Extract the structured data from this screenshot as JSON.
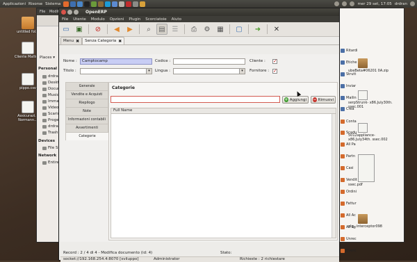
{
  "top_panel": {
    "menu": [
      "Applicazioni",
      "Risorse",
      "Sistema"
    ],
    "datetime": "mer 29 set, 17:05",
    "user": "drdran"
  },
  "desktop_icons": [
    {
      "label": "untitled fol..."
    },
    {
      "label": "Cliente Matte..."
    },
    {
      "label": "pippo.csv"
    },
    {
      "label": "Assicurazi... Normann..."
    }
  ],
  "file_manager_left": {
    "menu": [
      "File",
      "Modifi"
    ],
    "places_button": "Places ▾",
    "sections": {
      "personal": "Personal",
      "devices": "Devices",
      "network": "Network"
    },
    "personal_items": [
      "drdran",
      "Deskt",
      "Docum",
      "Music",
      "Imma",
      "Video",
      "Scaric",
      "Proge",
      "drdran",
      "Trash"
    ],
    "device_items": [
      "File Sy"
    ],
    "network_items": [
      "Entire"
    ]
  },
  "file_manager_right": {
    "files": [
      {
        "label": "ubeBeta#06201 0A.zip"
      },
      {
        "label": "serpStrunk- x86.July30th. ssec.001"
      },
      {
        "label": "5012appliance- x86.July34th. ssec.002"
      },
      {
        "label": "ssec.pdf"
      },
      {
        "label": "plg_ interceptor098"
      }
    ]
  },
  "oe_window": {
    "title": "OpenERP",
    "menu": [
      "File",
      "Utente",
      "Modulo",
      "Opzioni",
      "Plugin",
      "Scorciatoie",
      "Aiuto"
    ],
    "toolbar_icons": [
      "new-icon",
      "save-icon",
      "delete-icon",
      "previous-icon",
      "next-icon",
      "find-icon",
      "form-view-icon",
      "list-view-icon",
      "print-icon",
      "attach-icon",
      "print-preview-icon",
      "open-icon",
      "reload-icon",
      "close-icon"
    ],
    "tabs": [
      {
        "label": "Menu"
      },
      {
        "label": "Senza Categoria"
      }
    ],
    "form": {
      "nome_label": "Nome :",
      "nome_value": "Camptocamp",
      "codice_label": "Codice :",
      "codice_value": "",
      "cliente_label": "Cliente :",
      "cliente_checked": true,
      "titolo_label": "Titolo :",
      "titolo_value": "",
      "lingua_label": "Lingua :",
      "lingua_value": "",
      "fornitore_label": "Fornitore :",
      "fornitore_checked": true
    },
    "notebook_tabs": [
      "Generale",
      "Vendite e Acquisti",
      "Riepilogo",
      "Note",
      "Informazioni contabili",
      "Avvertimenti",
      "Categorie"
    ],
    "selected_tab": "Categorie",
    "categorie_page": {
      "title": "Categorie",
      "search_value": "",
      "add_button": "Aggiungi",
      "remove_button": "Rimuovi",
      "column_header": "Full Name",
      "rows": []
    },
    "status": {
      "record": "Record : 2 / 4 di 4 - Modifica documento (id: 4)",
      "state_label": "Stato:",
      "connection": "socket://192.168.254.4:8070 [sviluppo]",
      "user": "Administrator",
      "requests": "Richieste : 2 richiestare"
    }
  },
  "shortcuts": [
    "Ritardi",
    "Etiche",
    "Strutt",
    "Inviar",
    "Mailin",
    "Crea",
    "Conta",
    "Scadu",
    "All Pa",
    "Partn",
    "Casi",
    "Vendit",
    "Ordini",
    "Fattur",
    "All Ac",
    "All Re",
    "Unrec",
    "Event"
  ],
  "colors": {
    "accent_field": "#c8cdf4",
    "panel": "#393833",
    "check_red": "#c0201a"
  }
}
